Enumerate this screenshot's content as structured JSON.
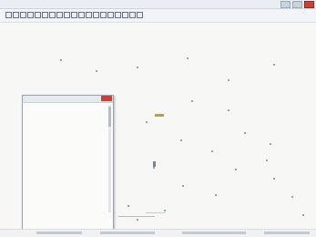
{
  "titlebar": {
    "title": ""
  },
  "toolbar": {
    "icons": [
      "new-icon",
      "open-icon",
      "save-icon",
      "print-icon",
      "cut-icon",
      "copy-icon",
      "paste-icon",
      "undo-icon",
      "redo-icon",
      "select-icon",
      "pan-icon",
      "zoom-icon",
      "grid-icon",
      "layer-icon",
      "label-icon",
      "measure-icon",
      "color-icon",
      "style-icon",
      "help-icon"
    ]
  },
  "dialog": {
    "rows": [
      {
        "label": "",
        "value": ""
      },
      {
        "label": "",
        "value": ""
      },
      {
        "label": "",
        "value": ""
      },
      {
        "label": "",
        "value": ""
      },
      {
        "label": "",
        "value": ""
      },
      {
        "label": "",
        "value": ""
      },
      {
        "label": "",
        "value": ""
      },
      {
        "label": "",
        "value": ""
      },
      {
        "label": "",
        "value": ""
      },
      {
        "label": "",
        "value": ""
      },
      {
        "label": "",
        "value": ""
      },
      {
        "label": "",
        "value": ""
      },
      {
        "label": "",
        "value": ""
      },
      {
        "label": "",
        "value": ""
      },
      {
        "label": "",
        "value": ""
      },
      {
        "label": "",
        "value": ""
      },
      {
        "label": "",
        "value": ""
      },
      {
        "label": "",
        "value": ""
      },
      {
        "label": "",
        "value": ""
      },
      {
        "label": "",
        "value": ""
      },
      {
        "label": "",
        "value": ""
      },
      {
        "label": "",
        "value": ""
      },
      {
        "label": "",
        "value": ""
      },
      {
        "label": "",
        "value": ""
      }
    ]
  },
  "colors": {
    "accent": "#c9423a",
    "marker": "#b9a13a"
  }
}
